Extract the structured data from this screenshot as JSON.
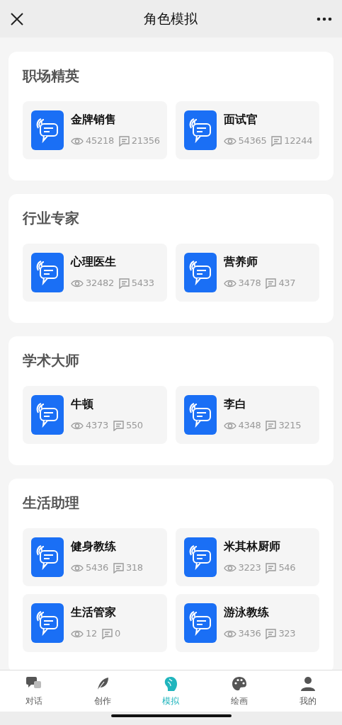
{
  "header": {
    "title": "角色模拟"
  },
  "sections": [
    {
      "title": "职场精英",
      "roles": [
        {
          "name": "金牌销售",
          "views": "45218",
          "comments": "21356"
        },
        {
          "name": "面试官",
          "views": "54365",
          "comments": "12244"
        }
      ]
    },
    {
      "title": "行业专家",
      "roles": [
        {
          "name": "心理医生",
          "views": "32482",
          "comments": "5433"
        },
        {
          "name": "营养师",
          "views": "3478",
          "comments": "437"
        }
      ]
    },
    {
      "title": "学术大师",
      "roles": [
        {
          "name": "牛顿",
          "views": "4373",
          "comments": "550"
        },
        {
          "name": "李白",
          "views": "4348",
          "comments": "3215"
        }
      ]
    },
    {
      "title": "生活助理",
      "roles": [
        {
          "name": "健身教练",
          "views": "5436",
          "comments": "318"
        },
        {
          "name": "米其林厨师",
          "views": "3223",
          "comments": "546"
        },
        {
          "name": "生活管家",
          "views": "12",
          "comments": "0"
        },
        {
          "name": "游泳教练",
          "views": "3436",
          "comments": "323"
        }
      ]
    }
  ],
  "tabs": [
    {
      "label": "对话",
      "kind": "chat",
      "selected": false
    },
    {
      "label": "创作",
      "kind": "feather",
      "selected": false
    },
    {
      "label": "模拟",
      "kind": "head",
      "selected": true
    },
    {
      "label": "绘画",
      "kind": "palette",
      "selected": false
    },
    {
      "label": "我的",
      "kind": "person",
      "selected": false
    }
  ]
}
